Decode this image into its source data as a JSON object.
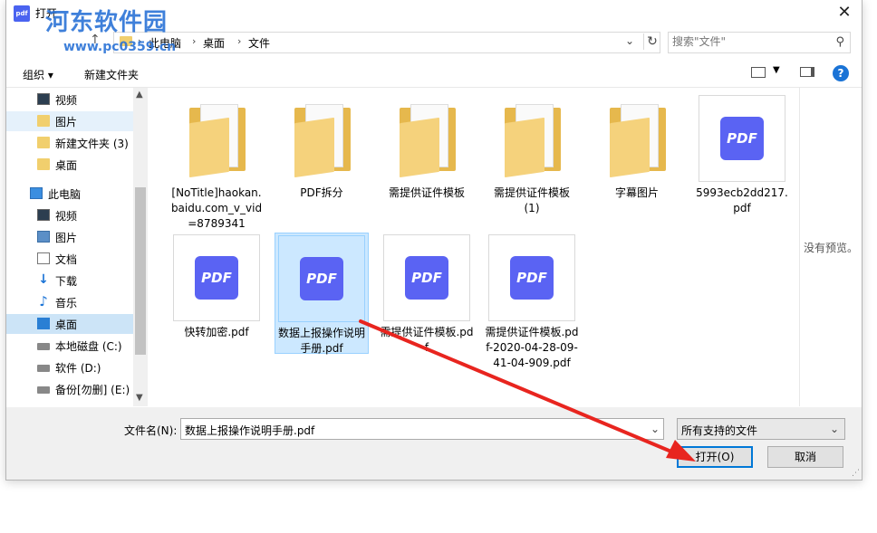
{
  "window": {
    "title": "打开",
    "app_icon_text": "pdf"
  },
  "watermark": {
    "text": "河东软件园",
    "url": "www.pc0359.cn"
  },
  "address": {
    "crumbs": [
      "此电脑",
      "桌面",
      "文件"
    ],
    "separator": "›"
  },
  "search": {
    "placeholder": "搜索\"文件\""
  },
  "toolbar": {
    "organize": "组织 ▾",
    "new_folder": "新建文件夹"
  },
  "nav": {
    "items": [
      {
        "label": "视频",
        "icon": "video-icon"
      },
      {
        "label": "图片",
        "icon": "folder-icon"
      },
      {
        "label": "新建文件夹 (3)",
        "icon": "folder-icon"
      },
      {
        "label": "桌面",
        "icon": "folder-icon"
      },
      {
        "label": "此电脑",
        "icon": "pc-icon"
      },
      {
        "label": "视频",
        "icon": "video-icon"
      },
      {
        "label": "图片",
        "icon": "picture-icon"
      },
      {
        "label": "文档",
        "icon": "document-icon"
      },
      {
        "label": "下载",
        "icon": "download-icon"
      },
      {
        "label": "音乐",
        "icon": "music-icon"
      },
      {
        "label": "桌面",
        "icon": "desktop-icon"
      },
      {
        "label": "本地磁盘 (C:)",
        "icon": "drive-icon"
      },
      {
        "label": "软件 (D:)",
        "icon": "drive-icon"
      },
      {
        "label": "备份[勿删] (E:)",
        "icon": "drive-icon"
      }
    ]
  },
  "files": [
    {
      "label": "[NoTitle]haokan.baidu.com_v_vid=8789341",
      "kind": "folder"
    },
    {
      "label": "PDF拆分",
      "kind": "folder"
    },
    {
      "label": "需提供证件模板",
      "kind": "folder"
    },
    {
      "label": "需提供证件模板 (1)",
      "kind": "folder"
    },
    {
      "label": "字幕图片",
      "kind": "folder"
    },
    {
      "label": "5993ecb2dd217.pdf",
      "kind": "pdf"
    },
    {
      "label": "快转加密.pdf",
      "kind": "pdf"
    },
    {
      "label": "数据上报操作说明手册.pdf",
      "kind": "pdf"
    },
    {
      "label": "需提供证件模板.pdf",
      "kind": "pdf"
    },
    {
      "label": "需提供证件模板.pdf-2020-04-28-09-41-04-909.pdf",
      "kind": "pdf"
    }
  ],
  "pdf_icon_text": "PDF",
  "preview": {
    "text": "没有预览。"
  },
  "bottom": {
    "filename_label": "文件名(N):",
    "filename_value": "数据上报操作说明手册.pdf",
    "filetype_value": "所有支持的文件",
    "open_button": "打开(O)",
    "cancel_button": "取消"
  },
  "colors": {
    "accent": "#0078d7",
    "pdf_icon": "#5a63f3",
    "folder": "#f1cf6d",
    "arrow": "#e8251f"
  }
}
